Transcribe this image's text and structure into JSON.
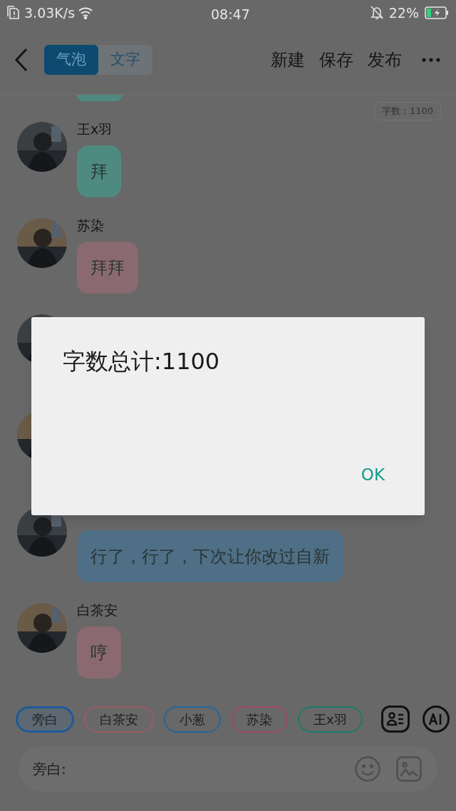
{
  "status_bar": {
    "network_speed": "3.03K/s",
    "time": "08:47",
    "battery": "22%"
  },
  "header": {
    "tabs": [
      {
        "label": "气泡",
        "selected": true
      },
      {
        "label": "文字",
        "selected": false
      }
    ],
    "actions": [
      "新建",
      "保存",
      "发布"
    ]
  },
  "word_count": "字数：1100",
  "messages": [
    {
      "kind": "partial",
      "color": "#4f8a80"
    },
    {
      "kind": "message",
      "name": "王x羽",
      "text": "拜",
      "color": "#4f8a80"
    },
    {
      "kind": "message",
      "name": "苏染",
      "text": "拜拜",
      "color": "#8a6a70"
    },
    {
      "kind": "covered"
    },
    {
      "kind": "covered"
    },
    {
      "kind": "message",
      "text": "行了，行了，下次让你改过自新",
      "color": "#4e6f85"
    },
    {
      "kind": "message",
      "name": "白茶安",
      "text": "哼",
      "color": "#8a6a70"
    }
  ],
  "roles": [
    {
      "label": "旁白",
      "color": "#1d5a9a",
      "selected": true
    },
    {
      "label": "白茶安",
      "color": "#9a5c62",
      "selected": false
    },
    {
      "label": "小葱",
      "color": "#23679a",
      "selected": false
    },
    {
      "label": "苏染",
      "color": "#9a4a62",
      "selected": false
    },
    {
      "label": "王x羽",
      "color": "#1a7a6a",
      "selected": false
    }
  ],
  "input": {
    "placeholder": "旁白:"
  },
  "dialog": {
    "message": "字数总计:1100",
    "button": "OK"
  }
}
